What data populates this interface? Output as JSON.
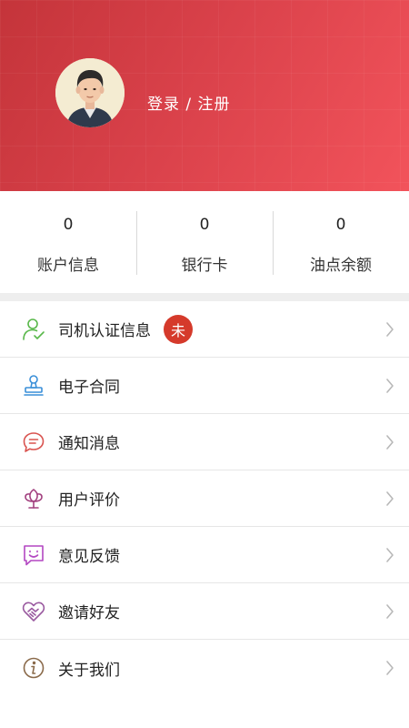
{
  "header": {
    "login_text": "登录 / 注册"
  },
  "stats": [
    {
      "value": "0",
      "label": "账户信息"
    },
    {
      "value": "0",
      "label": "银行卡"
    },
    {
      "value": "0",
      "label": "油点余额"
    }
  ],
  "menu": [
    {
      "label": "司机认证信息",
      "icon": "driver-verified-icon",
      "badge": "未"
    },
    {
      "label": "电子合同",
      "icon": "stamp-icon"
    },
    {
      "label": "通知消息",
      "icon": "message-icon"
    },
    {
      "label": "用户评价",
      "icon": "flower-icon"
    },
    {
      "label": "意见反馈",
      "icon": "smile-chat-icon"
    },
    {
      "label": "邀请好友",
      "icon": "handshake-icon"
    },
    {
      "label": "关于我们",
      "icon": "info-icon"
    }
  ],
  "colors": {
    "header_start": "#c4343a",
    "header_end": "#f2535b",
    "badge": "#d53a2b"
  }
}
